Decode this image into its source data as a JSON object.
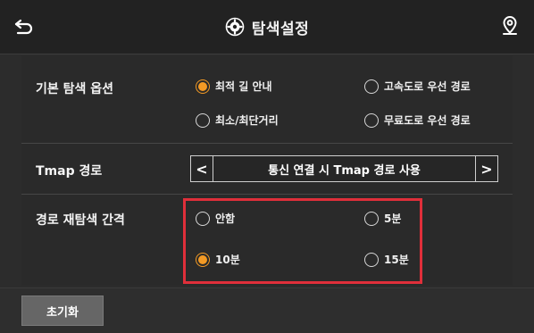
{
  "header": {
    "title": "탐색설정",
    "back_icon": "back-arrow-icon",
    "settings_icon": "gear-icon",
    "right_icon": "location-pin-icon"
  },
  "basic_search": {
    "label": "기본 탐색 옵션",
    "options": [
      {
        "label": "최적 길 안내",
        "selected": true
      },
      {
        "label": "고속도로 우선 경로",
        "selected": false
      },
      {
        "label": "최소/최단거리",
        "selected": false
      },
      {
        "label": "무료도로 우선 경로",
        "selected": false
      }
    ]
  },
  "tmap_route": {
    "label": "Tmap 경로",
    "value": "통신 연결 시 Tmap 경로 사용",
    "prev": "<",
    "next": ">"
  },
  "reroute_interval": {
    "label": "경로 재탐색 간격",
    "options": [
      {
        "label": "안함",
        "selected": false
      },
      {
        "label": "5분",
        "selected": false
      },
      {
        "label": "10분",
        "selected": true
      },
      {
        "label": "15분",
        "selected": false
      }
    ]
  },
  "footer": {
    "reset_label": "초기화"
  },
  "colors": {
    "accent": "#f39a25",
    "highlight": "#e02f3a"
  }
}
